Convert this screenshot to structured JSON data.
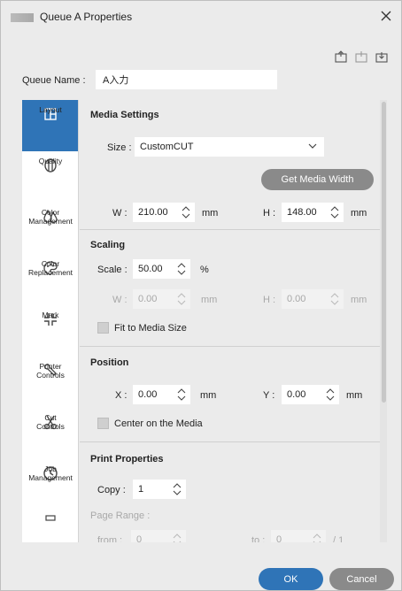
{
  "window": {
    "title": "Queue A Properties"
  },
  "queue": {
    "label": "Queue Name :",
    "value": "A入力"
  },
  "tabs": [
    {
      "label": "Layout",
      "icon": "layout-icon"
    },
    {
      "label": "Quality",
      "icon": "quality-icon"
    },
    {
      "label": "Color\nManagement",
      "icon": "color-management-icon"
    },
    {
      "label": "Color\nReplacement",
      "icon": "palette-icon"
    },
    {
      "label": "Mark",
      "icon": "mark-icon"
    },
    {
      "label": "Printer\nControls",
      "icon": "wrench-icon"
    },
    {
      "label": "Cut\nControls",
      "icon": "scissors-icon"
    },
    {
      "label": "Job\nManagement",
      "icon": "clock-icon"
    }
  ],
  "media": {
    "title": "Media Settings",
    "size_label": "Size :",
    "size_value": "CustomCUT",
    "get_width": "Get Media Width",
    "w_label": "W :",
    "w_value": "210.00",
    "h_label": "H :",
    "h_value": "148.00",
    "unit": "mm"
  },
  "scaling": {
    "title": "Scaling",
    "scale_label": "Scale :",
    "scale_value": "50.00",
    "scale_unit": "%",
    "w_label": "W :",
    "w_value": "0.00",
    "h_label": "H :",
    "h_value": "0.00",
    "unit": "mm",
    "fit_label": "Fit to Media Size"
  },
  "position": {
    "title": "Position",
    "x_label": "X :",
    "x_value": "0.00",
    "y_label": "Y :",
    "y_value": "0.00",
    "unit": "mm",
    "center_label": "Center on the Media"
  },
  "print": {
    "title": "Print Properties",
    "copy_label": "Copy :",
    "copy_value": "1",
    "range_label": "Page Range :",
    "from_label": "from :",
    "from_value": "0",
    "to_label": "to :",
    "to_value": "0",
    "total": "/ 1"
  },
  "footer": {
    "ok": "OK",
    "cancel": "Cancel"
  },
  "colors": {
    "accent": "#2f74b7",
    "gray_button": "#8a8a8a"
  }
}
